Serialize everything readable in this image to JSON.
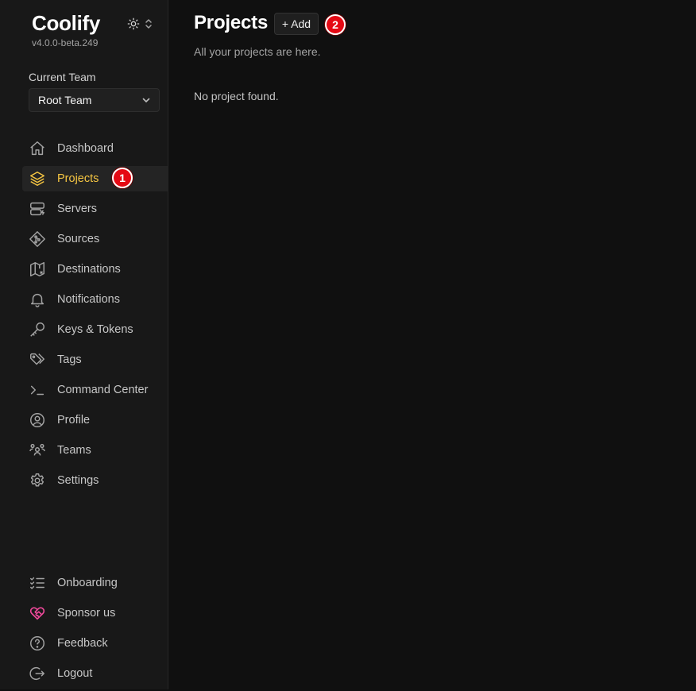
{
  "app": {
    "name": "Coolify",
    "version": "v4.0.0-beta.249"
  },
  "team": {
    "label": "Current Team",
    "selected": "Root Team"
  },
  "nav": {
    "items": [
      {
        "label": "Dashboard",
        "icon": "home-icon"
      },
      {
        "label": "Projects",
        "icon": "layers-icon",
        "active": true
      },
      {
        "label": "Servers",
        "icon": "server-icon"
      },
      {
        "label": "Sources",
        "icon": "git-branch-icon"
      },
      {
        "label": "Destinations",
        "icon": "map-icon"
      },
      {
        "label": "Notifications",
        "icon": "bell-icon"
      },
      {
        "label": "Keys & Tokens",
        "icon": "key-icon"
      },
      {
        "label": "Tags",
        "icon": "tags-icon"
      },
      {
        "label": "Command Center",
        "icon": "terminal-icon"
      },
      {
        "label": "Profile",
        "icon": "user-circle-icon"
      },
      {
        "label": "Teams",
        "icon": "users-icon"
      },
      {
        "label": "Settings",
        "icon": "gear-icon"
      }
    ],
    "bottom_items": [
      {
        "label": "Onboarding",
        "icon": "checklist-icon"
      },
      {
        "label": "Sponsor us",
        "icon": "heart-handshake-icon"
      },
      {
        "label": "Feedback",
        "icon": "help-circle-icon"
      },
      {
        "label": "Logout",
        "icon": "logout-icon"
      }
    ]
  },
  "main": {
    "title": "Projects",
    "add_label": "+ Add",
    "subtitle": "All your projects are here.",
    "empty_message": "No project found."
  },
  "badges": [
    "1",
    "2"
  ],
  "colors": {
    "active": "#f5c542",
    "sponsor": "#ec4899",
    "badge": "#e50914"
  }
}
